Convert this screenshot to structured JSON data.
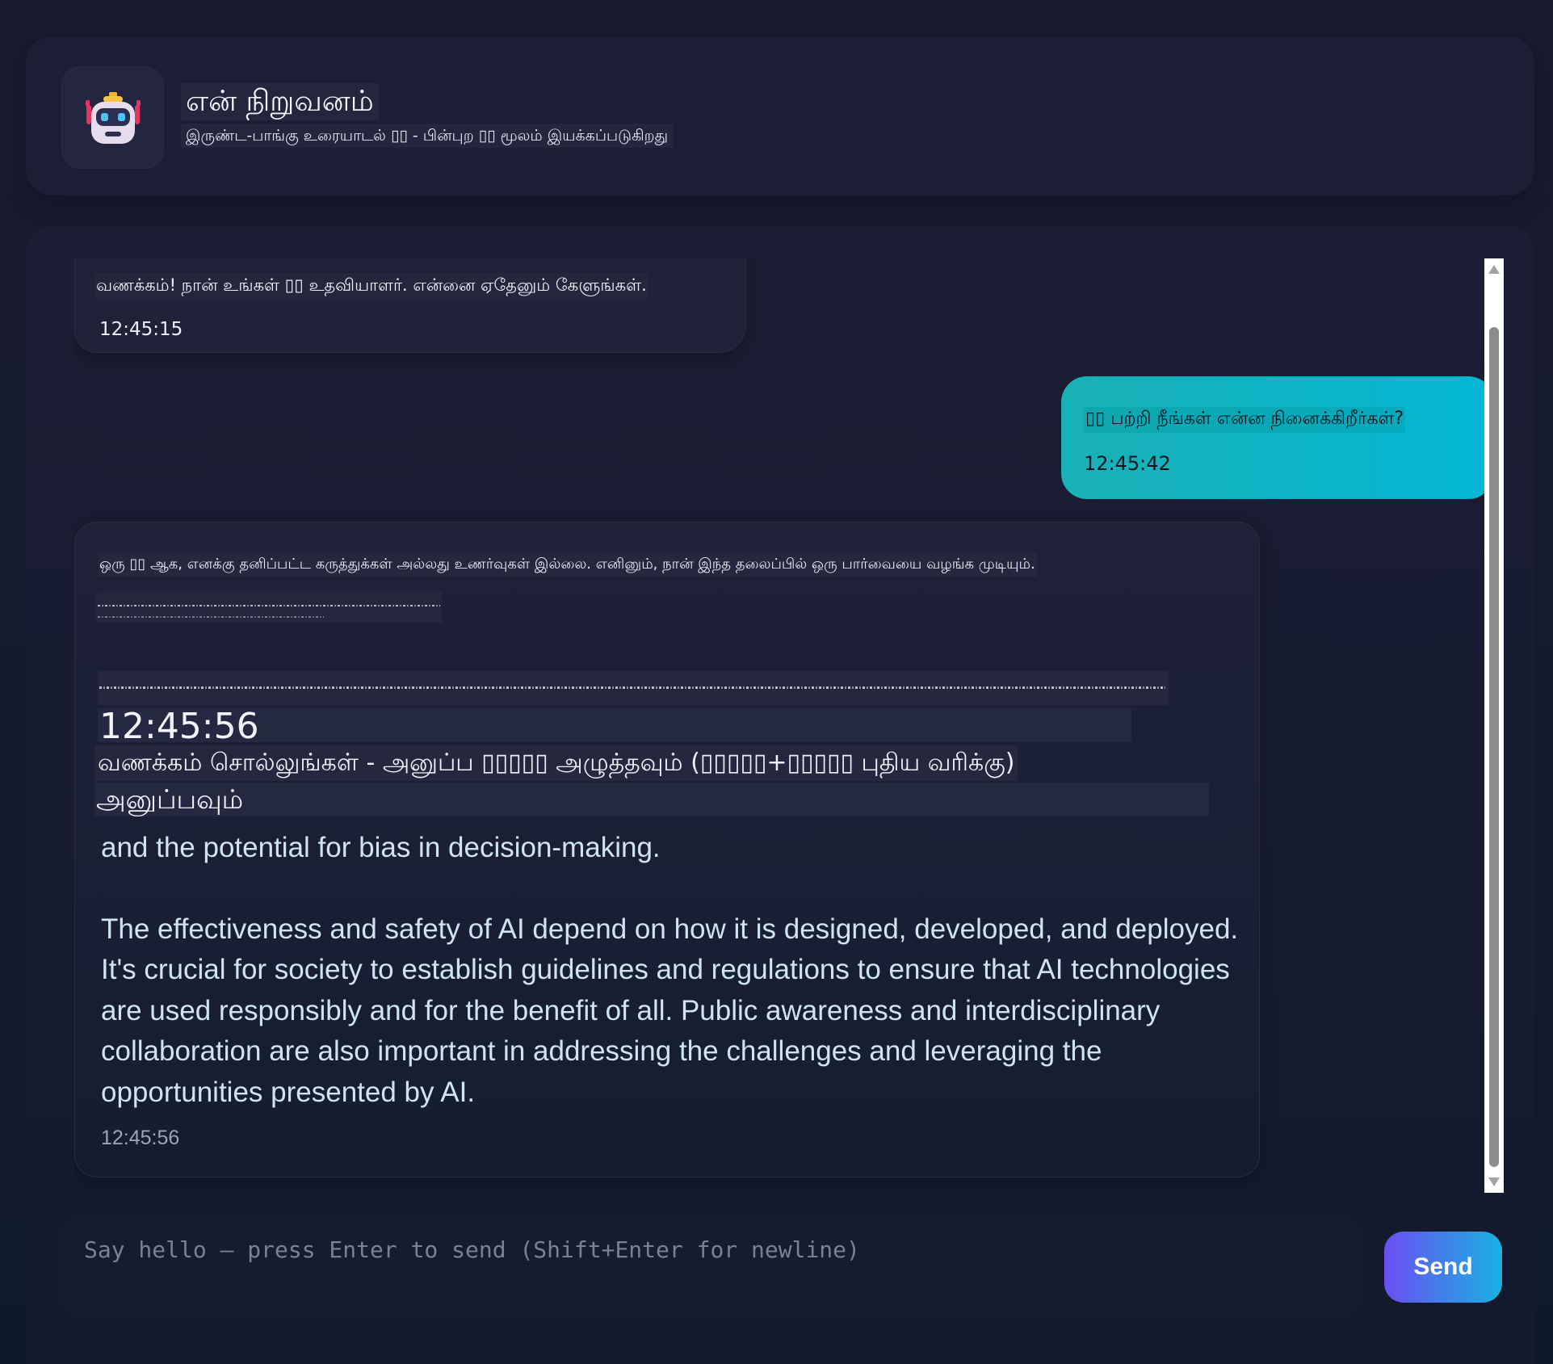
{
  "header": {
    "avatar_icon": "robot-icon",
    "title": "என் நிறுவனம்",
    "subtitle": "இருண்ட-பாங்கு உரையாடல் ▯▯ - பின்புற ▯▯ மூலம் இயக்கப்படுகிறது"
  },
  "messages": [
    {
      "role": "assistant",
      "text": "வணக்கம்! நான் உங்கள் ▯▯ உதவியாளர். என்னை ஏதேனும் கேளுங்கள்.",
      "time": "12:45:15"
    },
    {
      "role": "user",
      "text": "▯▯ பற்றி நீங்கள் என்ன நினைக்கிறீர்கள்?",
      "time": "12:45:42"
    },
    {
      "role": "assistant",
      "intro": "ஒரு ▯▯ ஆக, எனக்கு தனிப்பட்ட கருத்துக்கள் அல்லது உணர்வுகள் இல்லை. எனினும், நான் இந்த தலைப்பில் ஒரு பார்வையை வழங்க முடியும்.",
      "overlap_time": "12:45:56",
      "overlap_hint": "வணக்கம் சொல்லுங்கள் - அனுப்ப ▯▯▯▯▯ அழுத்தவும் (▯▯▯▯▯+▯▯▯▯▯ புதிய வரிக்கு)",
      "overlap_send": "அனுப்பவும்",
      "paragraphs": [
        "and the potential for bias in decision-making.",
        "The effectiveness and safety of AI depend on how it is designed, developed, and deployed. It's crucial for society to establish guidelines and regulations to ensure that AI technologies are used responsibly and for the benefit of all. Public awareness and interdisciplinary collaboration are also important in addressing the challenges and leveraging the opportunities presented by AI."
      ],
      "time": "12:45:56"
    }
  ],
  "composer": {
    "placeholder": "Say hello — press Enter to send (Shift+Enter for newline)",
    "send_label": "Send"
  },
  "colors": {
    "background": "#161a2f",
    "user_bubble": "#05b6d3",
    "send_start": "#6a4ff2",
    "send_end": "#18b2e0"
  }
}
